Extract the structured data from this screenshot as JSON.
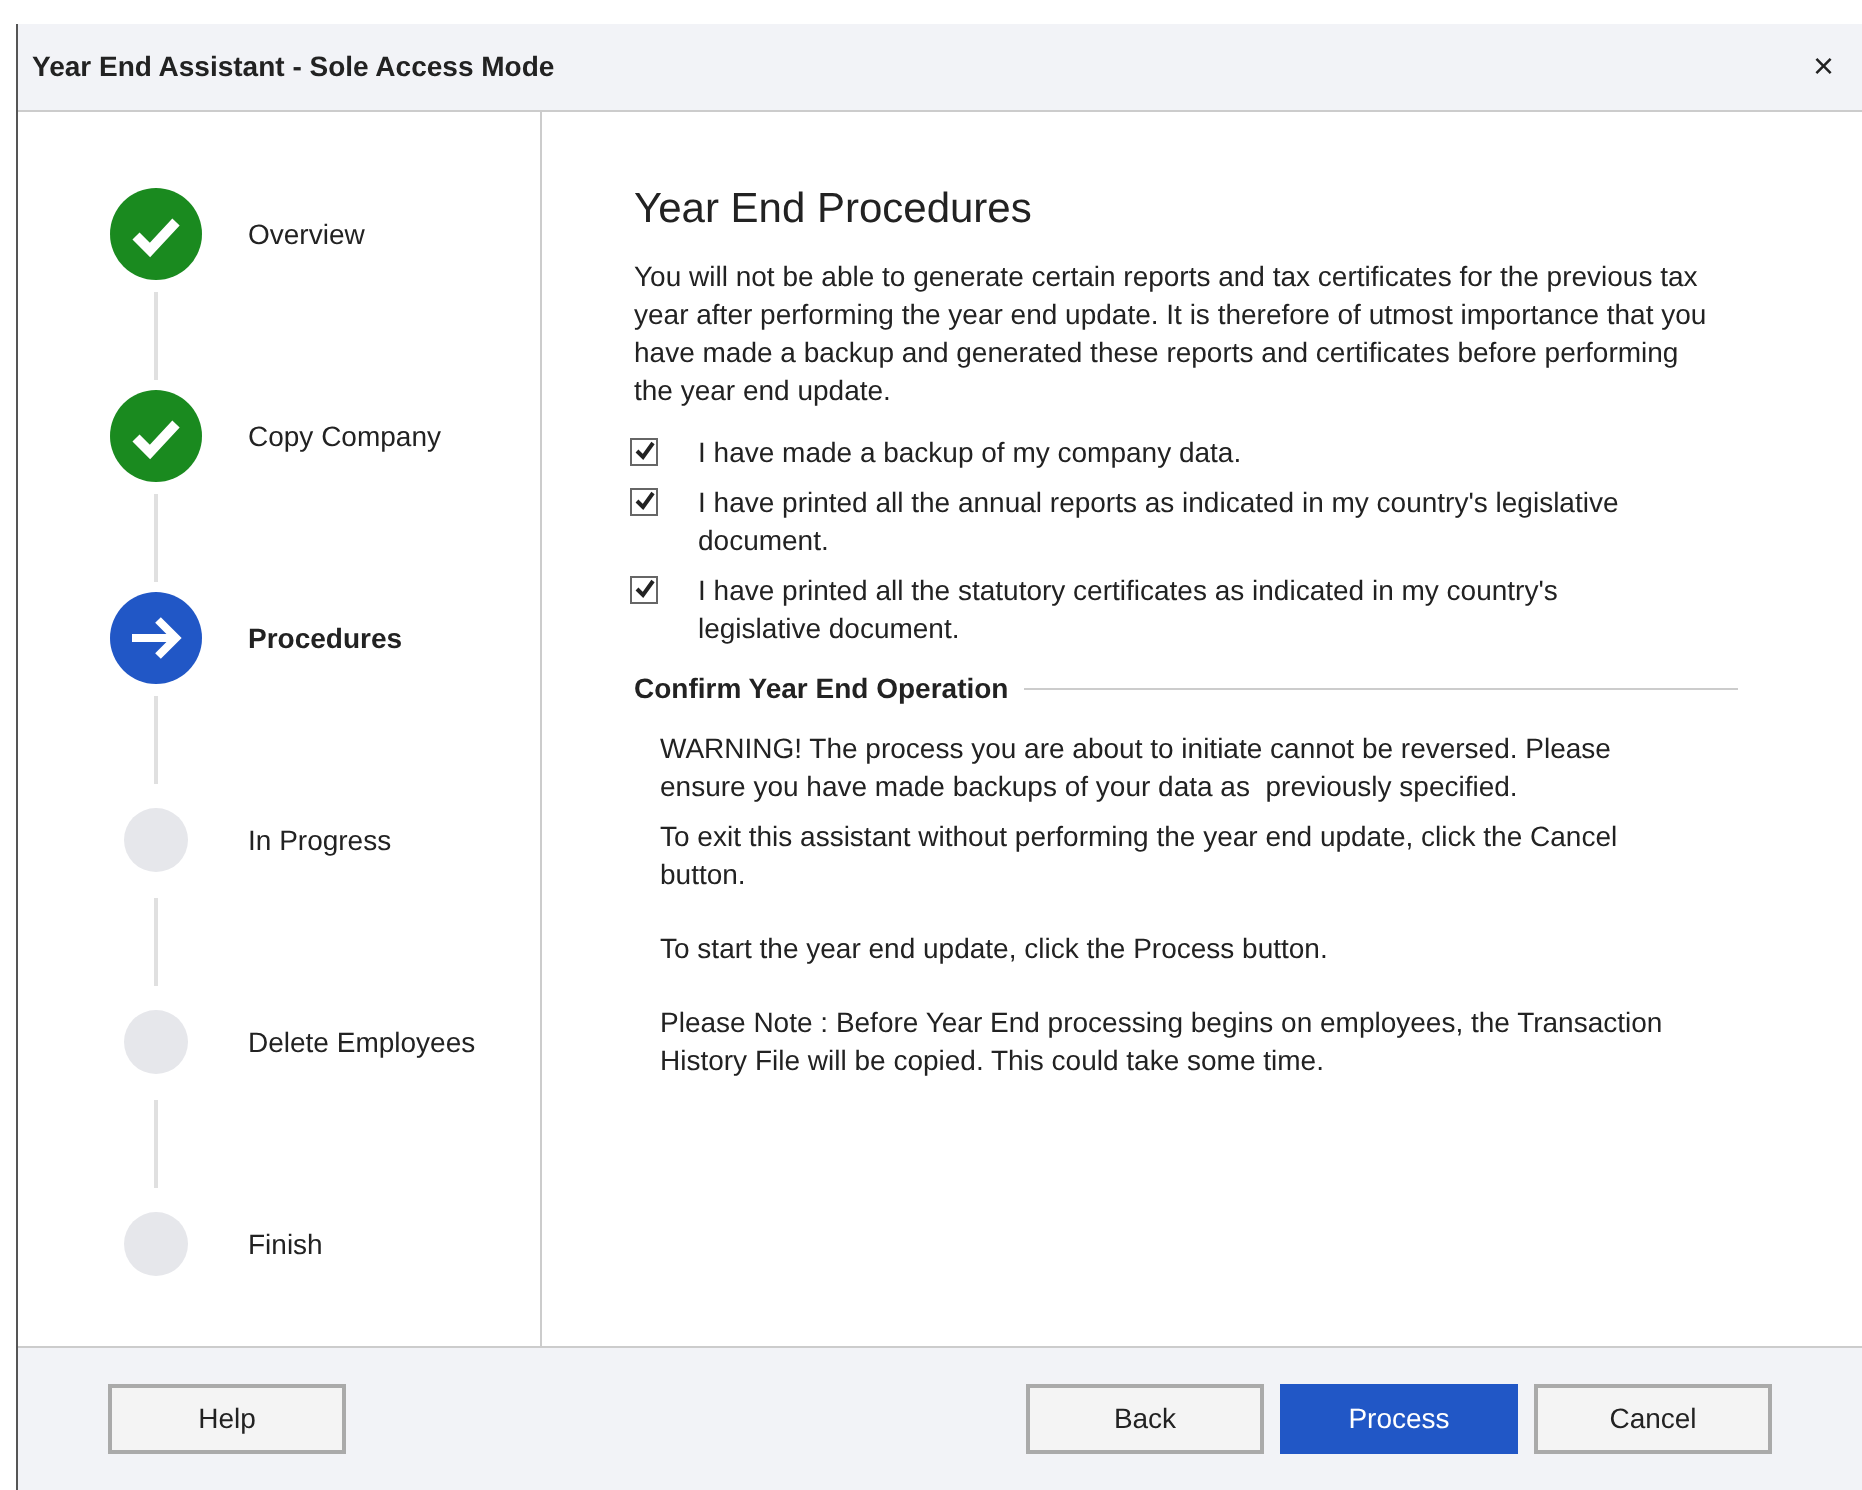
{
  "window": {
    "title": "Year End Assistant - Sole Access Mode",
    "close": "×"
  },
  "steps": [
    {
      "label": "Overview",
      "kind": "done",
      "selected": false
    },
    {
      "label": "Copy Company",
      "kind": "done",
      "selected": false
    },
    {
      "label": "Procedures",
      "kind": "current",
      "selected": true
    },
    {
      "label": "In Progress",
      "kind": "pending",
      "selected": false
    },
    {
      "label": "Delete Employees",
      "kind": "pending",
      "selected": false
    },
    {
      "label": "Finish",
      "kind": "pending",
      "selected": false
    }
  ],
  "heading": "Year End Procedures",
  "intro": "You will not be able to generate certain reports and tax certificates for the previous tax year after performing the year end update. It is therefore of utmost importance that you have made a backup and generated these reports and certificates before performing the year end update.",
  "checks": [
    {
      "label": "I have made a backup of my company data.",
      "checked": true
    },
    {
      "label": "I have printed all the annual reports as indicated in my country's legislative document.",
      "checked": true
    },
    {
      "label": "I have printed all the statutory certificates as indicated in my country's legislative document.",
      "checked": true
    }
  ],
  "confirm": {
    "title": "Confirm Year End Operation",
    "paragraphs": [
      "WARNING! The process you are about to initiate cannot be reversed. Please ensure you have made backups of your data as  previously specified.",
      "To exit this assistant without performing the year end update, click the Cancel button.",
      "To start the year end update, click the Process button.",
      "Please Note : Before Year End processing begins on employees, the Transaction History File will be copied. This could take some time."
    ]
  },
  "buttons": [
    {
      "label": "Help",
      "primary": false
    },
    {
      "label": "Back",
      "primary": false
    },
    {
      "label": "Process",
      "primary": true
    },
    {
      "label": "Cancel",
      "primary": false
    }
  ]
}
